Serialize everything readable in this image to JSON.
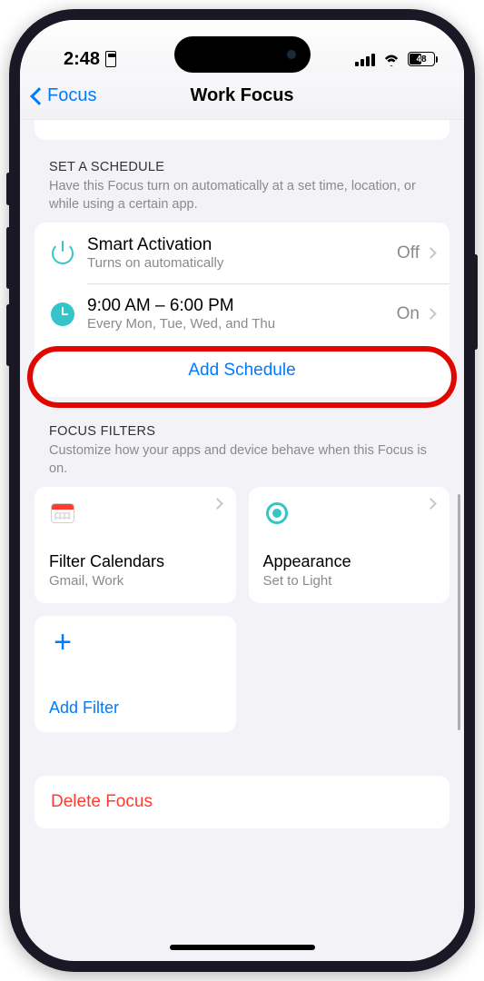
{
  "status": {
    "time": "2:48",
    "battery": "48",
    "battery_pct": 48
  },
  "nav": {
    "back": "Focus",
    "title": "Work Focus"
  },
  "schedule": {
    "heading": "SET A SCHEDULE",
    "desc": "Have this Focus turn on automatically at a set time, location, or while using a certain app.",
    "items": [
      {
        "title": "Smart Activation",
        "sub": "Turns on automatically",
        "state": "Off"
      },
      {
        "title": "9:00 AM – 6:00 PM",
        "sub": "Every Mon, Tue, Wed, and Thu",
        "state": "On"
      }
    ],
    "add": "Add Schedule"
  },
  "filters": {
    "heading": "FOCUS FILTERS",
    "desc": "Customize how your apps and device behave when this Focus is on.",
    "tiles": [
      {
        "title": "Filter Calendars",
        "sub": "Gmail, Work"
      },
      {
        "title": "Appearance",
        "sub": "Set to Light"
      }
    ],
    "add": "Add Filter"
  },
  "delete": "Delete Focus"
}
